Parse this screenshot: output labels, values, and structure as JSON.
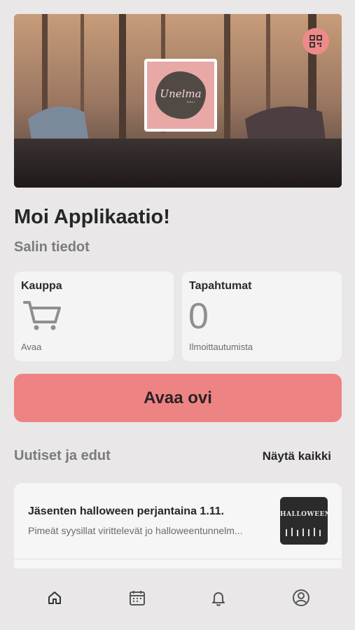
{
  "hero": {
    "logo_text": "Unelma",
    "logo_sub": "SALI",
    "qr_icon": "qr-code-icon"
  },
  "greeting": "Moi Applikaatio!",
  "section_title": "Salin tiedot",
  "cards": {
    "shop": {
      "title": "Kauppa",
      "icon": "shopping-cart-icon",
      "caption": "Avaa"
    },
    "events": {
      "title": "Tapahtumat",
      "count": "0",
      "caption": "Ilmoittautumista"
    }
  },
  "open_door_label": "Avaa ovi",
  "news": {
    "header": "Uutiset ja edut",
    "show_all": "Näytä kaikki",
    "items": [
      {
        "title": "Jäsenten halloween perjantaina 1.11.",
        "description": "Pimeät syysillat virittelevät jo halloweentunnelm...",
        "thumb_title": "HALLOWEEN"
      }
    ]
  },
  "tabbar": {
    "items": [
      {
        "icon": "home-icon"
      },
      {
        "icon": "calendar-icon"
      },
      {
        "icon": "bell-icon"
      },
      {
        "icon": "user-icon"
      }
    ]
  },
  "colors": {
    "accent": "#ee8384",
    "background": "#e9e7e7",
    "card": "#f5f4f4"
  }
}
